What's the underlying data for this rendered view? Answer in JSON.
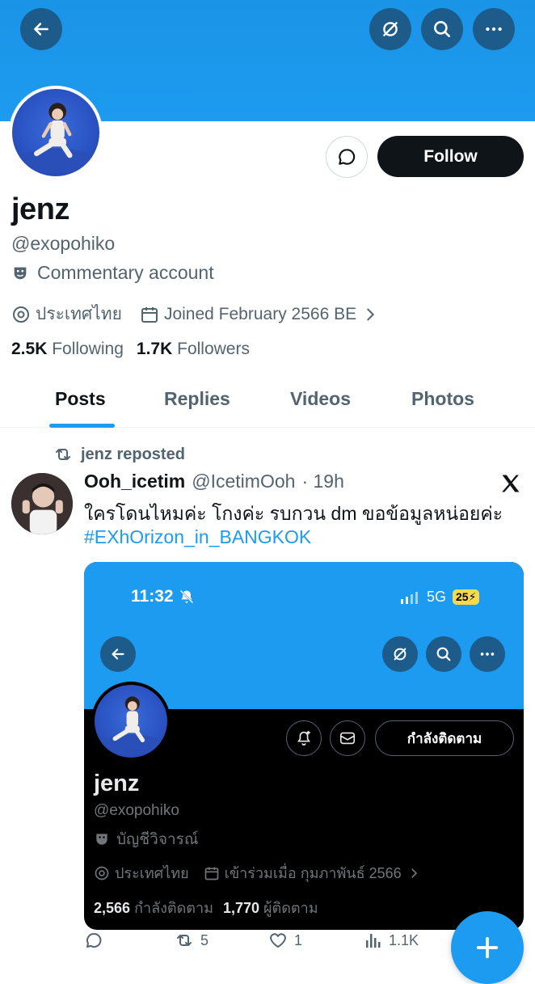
{
  "profile": {
    "name": "jenz",
    "handle": "@exopohiko",
    "label": "Commentary account",
    "location": "ประเทศไทย",
    "joined": "Joined February 2566 BE",
    "following_count": "2.5K",
    "following_label": "Following",
    "followers_count": "1.7K",
    "followers_label": "Followers",
    "follow_button": "Follow"
  },
  "tabs": [
    {
      "label": "Posts",
      "active": true
    },
    {
      "label": "Replies",
      "active": false
    },
    {
      "label": "Videos",
      "active": false
    },
    {
      "label": "Photos",
      "active": false
    }
  ],
  "post": {
    "repost_label": "jenz reposted",
    "author_name": "Ooh_icetim",
    "author_handle": "@IcetimOoh",
    "time": "· 19h",
    "text": "ใครโดนไหมค่ะ โกงค่ะ รบกวน dm ขอข้อมูลหน่อยค่ะ",
    "hashtag": "#EXhOrizon_in_BANGKOK",
    "replies": "",
    "reposts": "5",
    "likes": "1",
    "views": "1.1K"
  },
  "embed": {
    "time": "11:32",
    "network": "5G",
    "battery": "25",
    "name": "jenz",
    "handle": "@exopohiko",
    "label": "บัญชีวิจารณ์",
    "location": "ประเทศไทย",
    "joined": "เข้าร่วมเมื่อ กุมภาพันธ์ 2566",
    "following_count": "2,566",
    "following_label": "กำลังติดตาม",
    "followers_count": "1,770",
    "followers_label": "ผู้ติดตาม",
    "follow_button": "กำลังติดตาม"
  },
  "colors": {
    "accent": "#1d9bf0",
    "button_dark": "#0f1419",
    "secondary_text": "#536471"
  }
}
